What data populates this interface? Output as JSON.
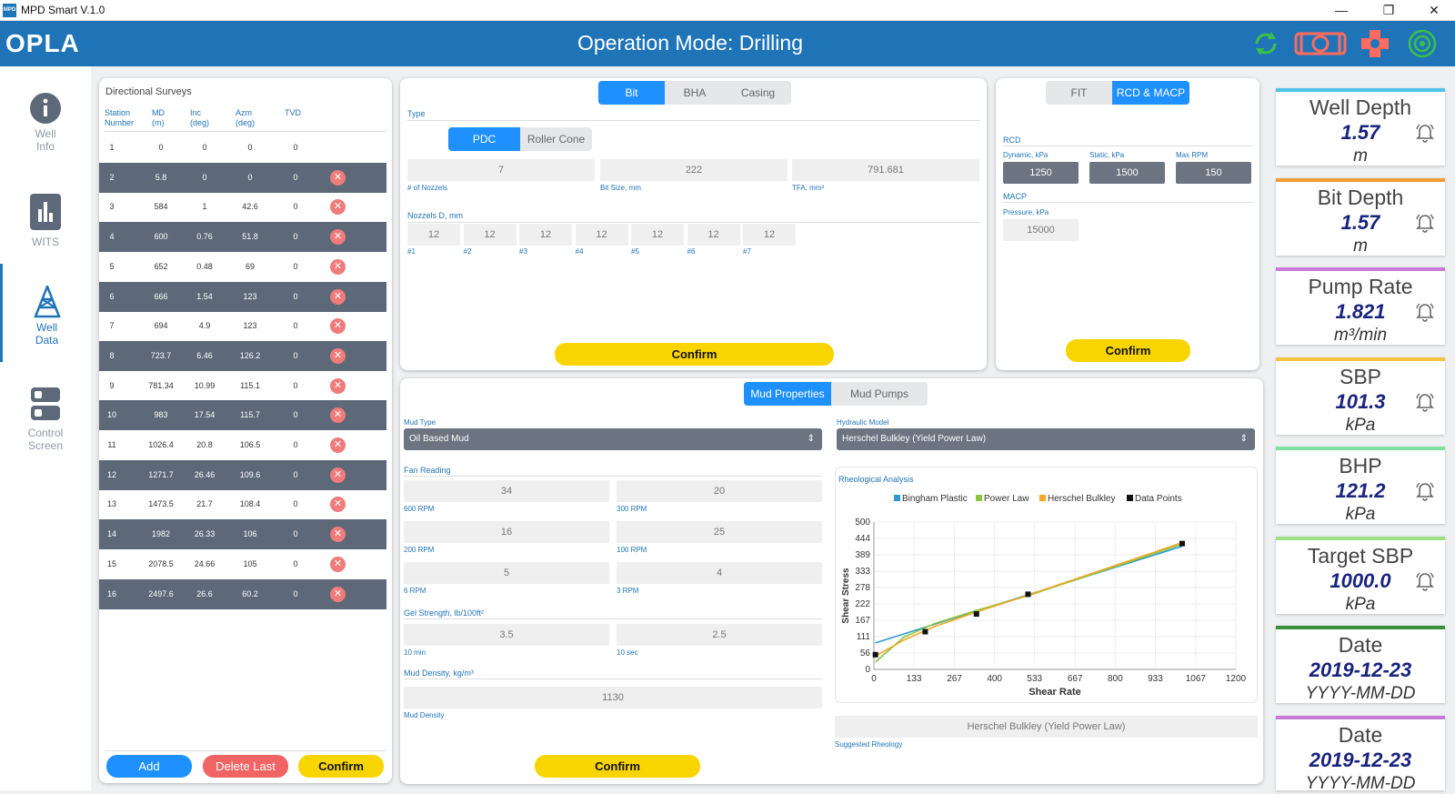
{
  "window": {
    "title": "MPD Smart V.1.0",
    "min": "—",
    "restore": "❐",
    "close": "✕"
  },
  "header": {
    "logo": "OPLA",
    "mode_title": "Operation Mode: Drilling"
  },
  "nav": [
    {
      "label1": "Well",
      "label2": "Info"
    },
    {
      "label1": "WITS",
      "label2": ""
    },
    {
      "label1": "Well",
      "label2": "Data"
    },
    {
      "label1": "Control",
      "label2": "Screen"
    }
  ],
  "surveys": {
    "title": "Directional Surveys",
    "headers": [
      {
        "l1": "Station",
        "l2": "Number"
      },
      {
        "l1": "MD",
        "l2": "(m)"
      },
      {
        "l1": "Inc",
        "l2": "(deg)"
      },
      {
        "l1": "Azm",
        "l2": "(deg)"
      },
      {
        "l1": "TVD",
        "l2": ""
      }
    ],
    "rows": [
      [
        "1",
        "0",
        "0",
        "0",
        "0"
      ],
      [
        "2",
        "5.8",
        "0",
        "0",
        "0"
      ],
      [
        "3",
        "584",
        "1",
        "42.6",
        "0"
      ],
      [
        "4",
        "600",
        "0.76",
        "51.8",
        "0"
      ],
      [
        "5",
        "652",
        "0.48",
        "69",
        "0"
      ],
      [
        "6",
        "666",
        "1.54",
        "123",
        "0"
      ],
      [
        "7",
        "694",
        "4.9",
        "123",
        "0"
      ],
      [
        "8",
        "723.7",
        "6.46",
        "126.2",
        "0"
      ],
      [
        "9",
        "781.34",
        "10.99",
        "115.1",
        "0"
      ],
      [
        "10",
        "983",
        "17.54",
        "115.7",
        "0"
      ],
      [
        "11",
        "1026.4",
        "20.8",
        "106.5",
        "0"
      ],
      [
        "12",
        "1271.7",
        "26.46",
        "109.6",
        "0"
      ],
      [
        "13",
        "1473.5",
        "21.7",
        "108.4",
        "0"
      ],
      [
        "14",
        "1982",
        "26.33",
        "106",
        "0"
      ],
      [
        "15",
        "2078.5",
        "24.66",
        "105",
        "0"
      ],
      [
        "16",
        "2497.6",
        "26.6",
        "60.2",
        "0"
      ]
    ],
    "delete_symbol": "✕",
    "add_label": "Add",
    "delete_last_label": "Delete Last",
    "confirm_label": "Confirm"
  },
  "bit": {
    "tabs": [
      "Bit",
      "BHA",
      "Casing"
    ],
    "active_tab": 0,
    "type_label": "Type",
    "type_options": [
      "PDC",
      "Roller Cone"
    ],
    "nozzles_count": "7",
    "nozzles_count_label": "# of Nozzels",
    "bit_size": "222",
    "bit_size_label": "Bit Size, mm",
    "tfa": "791.681",
    "tfa_label": "TFA, mm²",
    "nozzles_d_label": "Nozzels D, mm",
    "nozzles": [
      {
        "v": "12",
        "l": "#1"
      },
      {
        "v": "12",
        "l": "#2"
      },
      {
        "v": "12",
        "l": "#3"
      },
      {
        "v": "12",
        "l": "#4"
      },
      {
        "v": "12",
        "l": "#5"
      },
      {
        "v": "12",
        "l": "#6"
      },
      {
        "v": "12",
        "l": "#7"
      }
    ],
    "confirm_label": "Confirm"
  },
  "rcd": {
    "tabs": [
      "FIT",
      "RCD & MACP"
    ],
    "active_tab": 1,
    "rcd_label": "RCD",
    "dynamic_label": "Dynamic, kPa",
    "dynamic": "1250",
    "static_label": "Static, kPa",
    "static": "1500",
    "maxrpm_label": "Max RPM",
    "maxrpm": "150",
    "macp_label": "MACP",
    "pressure_label": "Pressure, kPa",
    "pressure": "15000",
    "confirm_label": "Confirm"
  },
  "mud": {
    "tabs": [
      "Mud Properties",
      "Mud Pumps"
    ],
    "active_tab": 0,
    "mud_type_label": "Mud Type",
    "mud_type": "Oil Based Mud",
    "fan_label": "Fan Reading",
    "fan": [
      {
        "v": "34",
        "l": "600 RPM"
      },
      {
        "v": "20",
        "l": "300 RPM"
      },
      {
        "v": "16",
        "l": "200 RPM"
      },
      {
        "v": "25",
        "l": "100 RPM"
      },
      {
        "v": "5",
        "l": "6 RPM"
      },
      {
        "v": "4",
        "l": "3 RPM"
      }
    ],
    "gel_label": "Gel Strength, lb/100ft²",
    "gel": [
      {
        "v": "3.5",
        "l": "10 min"
      },
      {
        "v": "2.5",
        "l": "10 sec"
      }
    ],
    "density_label": "Mud Density, kg/m³",
    "density": "1130",
    "density_sub": "Mud Density",
    "hydraulic_label": "Hydraulic Model",
    "hydraulic": "Herschel Bulkley (Yield Power Law)",
    "rheo_label": "Rheological Analysis",
    "suggested": "Herschel Bulkley (Yield Power Law)",
    "suggested_label": "Suggested Rheology",
    "confirm_label": "Confirm"
  },
  "chart_data": {
    "type": "line",
    "xlabel": "Shear Rate",
    "ylabel": "Shear Stress",
    "xlim": [
      0,
      1200
    ],
    "ylim": [
      0,
      500
    ],
    "xticks": [
      "0",
      "133",
      "267",
      "400",
      "533",
      "667",
      "800",
      "933",
      "1067",
      "1200"
    ],
    "yticks": [
      "0",
      "56",
      "111",
      "167",
      "222",
      "278",
      "333",
      "389",
      "444",
      "500"
    ],
    "legend": [
      "Bingham Plastic",
      "Power Law",
      "Herschel Bulkley",
      "Data Points"
    ],
    "colors": {
      "bingham": "#2e9bd6",
      "power": "#8cc63f",
      "herschel": "#f5a623",
      "points": "#111111"
    },
    "series": [
      {
        "name": "Bingham Plastic",
        "x": [
          5,
          1022
        ],
        "y": [
          90,
          418
        ]
      },
      {
        "name": "Power Law",
        "x": [
          5,
          100,
          200,
          340,
          511,
          1022
        ],
        "y": [
          25,
          110,
          155,
          200,
          250,
          425
        ]
      },
      {
        "name": "Herschel Bulkley",
        "x": [
          5,
          100,
          200,
          340,
          511,
          1022
        ],
        "y": [
          45,
          100,
          145,
          195,
          252,
          430
        ]
      },
      {
        "name": "Data Points",
        "x": [
          5,
          170,
          340,
          511,
          1022
        ],
        "y": [
          50,
          128,
          188,
          255,
          427
        ]
      }
    ]
  },
  "gauges": [
    {
      "title": "Well Depth",
      "value": "1.57",
      "unit": "m",
      "color": "#4dc3e8"
    },
    {
      "title": "Bit Depth",
      "value": "1.57",
      "unit": "m",
      "color": "#f29b38"
    },
    {
      "title": "Pump Rate",
      "value": "1.821",
      "unit": "m³/min",
      "color": "#c77ad6"
    },
    {
      "title": "SBP",
      "value": "101.3",
      "unit": "kPa",
      "color": "#f5c542"
    },
    {
      "title": "BHP",
      "value": "121.2",
      "unit": "kPa",
      "color": "#7fe0a0"
    },
    {
      "title": "Target SBP",
      "value": "1000.0",
      "unit": "kPa",
      "color": "#9ee08a"
    },
    {
      "title": "Date",
      "value": "2019-12-23",
      "unit": "YYYY-MM-DD",
      "color": "#3a8f3a"
    },
    {
      "title": "Date",
      "value": "2019-12-23",
      "unit": "YYYY-MM-DD",
      "color": "#c77ad6"
    }
  ]
}
